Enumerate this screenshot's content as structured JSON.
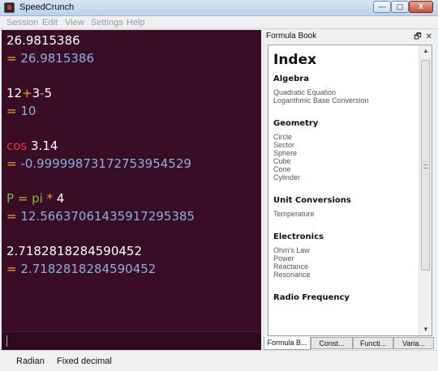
{
  "window": {
    "title": "SpeedCrunch"
  },
  "menu": [
    "Session",
    "Edit",
    "View",
    "Settings",
    "Help"
  ],
  "results": [
    {
      "expr": [
        {
          "t": "26.9815386",
          "c": "w"
        }
      ],
      "res": "26.9815386"
    },
    {
      "expr": [
        {
          "t": "12",
          "c": "w"
        },
        {
          "t": "+",
          "c": "y"
        },
        {
          "t": "3",
          "c": "w"
        },
        {
          "t": "-",
          "c": "y"
        },
        {
          "t": "5",
          "c": "w"
        }
      ],
      "res": "10"
    },
    {
      "expr": [
        {
          "t": "cos",
          "c": "r"
        },
        {
          "t": " 3.14",
          "c": "w"
        }
      ],
      "res": "-0.99999873172753954529"
    },
    {
      "expr": [
        {
          "t": "P",
          "c": "g"
        },
        {
          "t": " = ",
          "c": "y"
        },
        {
          "t": "pi",
          "c": "g"
        },
        {
          "t": " * ",
          "c": "y"
        },
        {
          "t": "4",
          "c": "w"
        }
      ],
      "res": "12.56637061435917295385"
    },
    {
      "expr": [
        {
          "t": "2.7182818284590452",
          "c": "w"
        }
      ],
      "res": "2.7182818284590452"
    }
  ],
  "result_prefix": "= ",
  "status": {
    "angle": "Radian",
    "format": "Fixed decimal"
  },
  "dock": {
    "title": "Formula Book",
    "float_glyph": "🗗",
    "close_glyph": "✕",
    "index_title": "Index",
    "sections": [
      {
        "heading": "Algebra",
        "items": [
          "Quadratic Equation",
          "Logarithmic Base Conversion"
        ]
      },
      {
        "heading": "Geometry",
        "items": [
          "Circle",
          "Sector",
          "Sphere",
          "Cube",
          "Cone",
          "Cylinder"
        ]
      },
      {
        "heading": "Unit Conversions",
        "items": [
          "Temperature"
        ]
      },
      {
        "heading": "Electronics",
        "items": [
          "Ohm's Law",
          "Power",
          "Reactance",
          "Resonance"
        ]
      },
      {
        "heading": "Radio Frequency",
        "items": []
      }
    ],
    "tabs": [
      "Formula B...",
      "Const...",
      "Functi...",
      "Varia..."
    ]
  },
  "window_buttons": {
    "minimize": "—",
    "maximize": "▢",
    "close": "X"
  },
  "scroll": {
    "up": "▲",
    "down": "▼"
  }
}
